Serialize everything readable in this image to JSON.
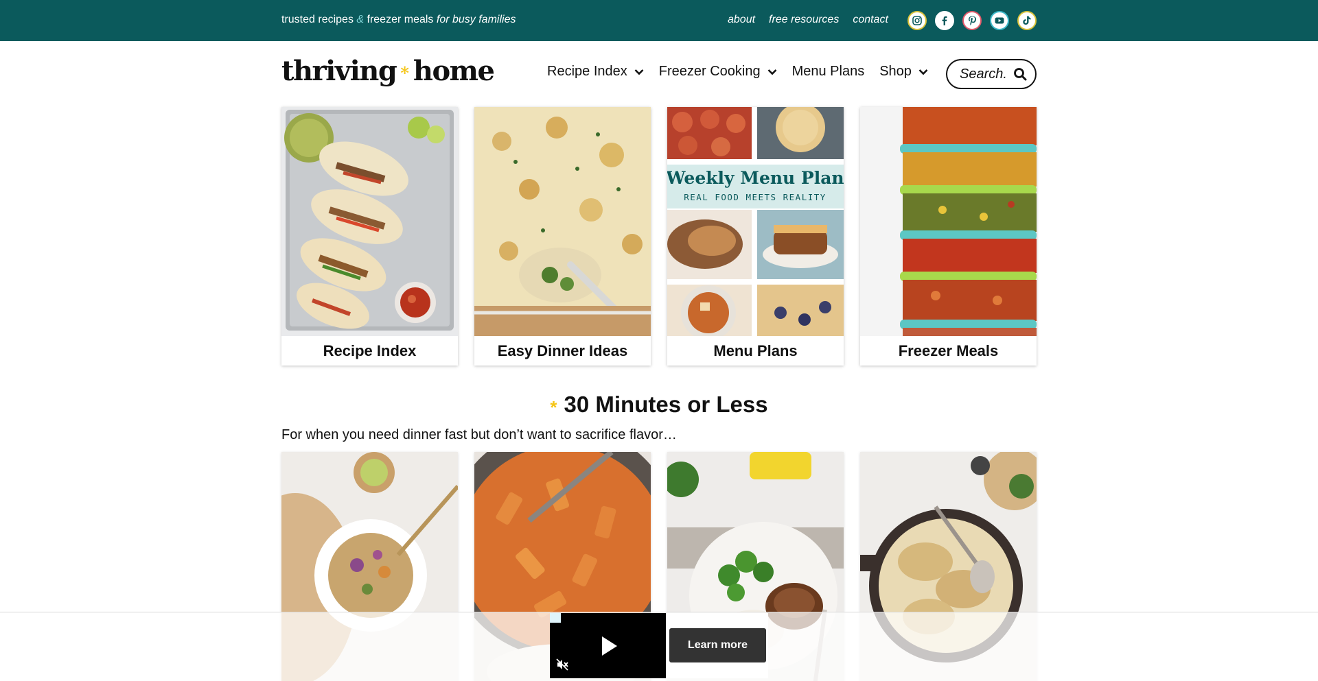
{
  "topbar": {
    "tagline": {
      "part1": "trusted recipes ",
      "amp": "&",
      "part2": " freezer meals ",
      "part3": "for busy families"
    },
    "links": [
      "about",
      "free resources",
      "contact"
    ],
    "socials": [
      {
        "icon": "instagram-icon",
        "color": "#d9c23a"
      },
      {
        "icon": "facebook-icon",
        "color": "#ffffff"
      },
      {
        "icon": "pinterest-icon",
        "color": "#e05a6a"
      },
      {
        "icon": "youtube-icon",
        "color": "#3ab8c8"
      },
      {
        "icon": "tiktok-icon",
        "color": "#d9c23a"
      }
    ],
    "bg_color": "#0b5a5c"
  },
  "header": {
    "logo_left": "thriving",
    "logo_star": "*",
    "logo_right": "home",
    "nav": [
      {
        "label": "Recipe Index",
        "has_dropdown": true
      },
      {
        "label": "Freezer Cooking",
        "has_dropdown": true
      },
      {
        "label": "Menu Plans",
        "has_dropdown": false
      },
      {
        "label": "Shop",
        "has_dropdown": true
      }
    ],
    "search_placeholder": "Search."
  },
  "categories": [
    {
      "label": "Recipe Index"
    },
    {
      "label": "Easy Dinner Ideas"
    },
    {
      "label": "Menu Plans",
      "image_title": "Weekly Menu Plan",
      "image_subtitle": "REAL FOOD MEETS REALITY"
    },
    {
      "label": "Freezer Meals"
    }
  ],
  "section": {
    "star": "*",
    "title": "30 Minutes or Less",
    "description": "For when you need dinner fast but don’t want to sacrifice flavor…"
  },
  "ad": {
    "cta": "Learn more"
  }
}
